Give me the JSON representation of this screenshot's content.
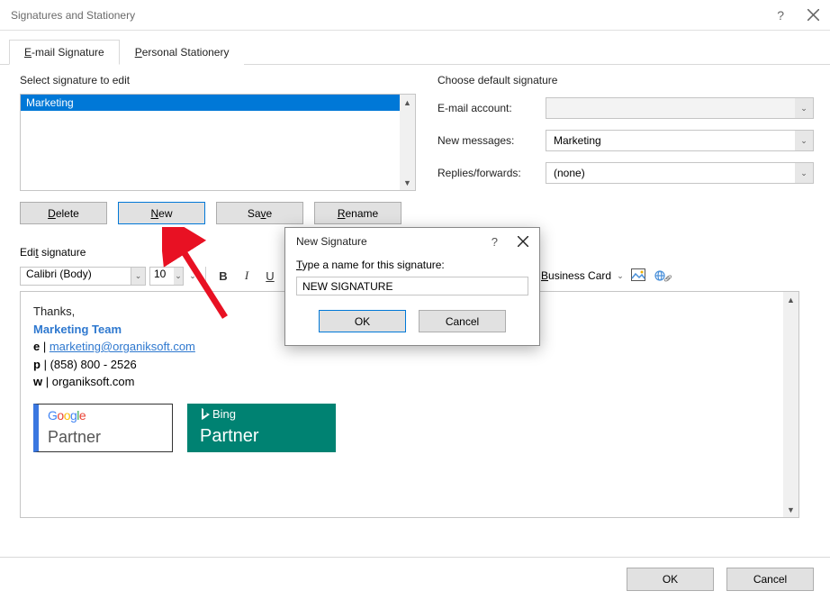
{
  "titlebar": {
    "title": "Signatures and Stationery"
  },
  "tabs": {
    "email": "E-mail Signature",
    "personal": "Personal Stationery"
  },
  "select_label": "Select signature to edit",
  "signatures": [
    "Marketing"
  ],
  "buttons": {
    "delete": "Delete",
    "new": "New",
    "save": "Save",
    "rename": "Rename"
  },
  "defaults": {
    "heading": "Choose default signature",
    "email_account_label": "E-mail account:",
    "email_account_value": "",
    "new_messages_label": "New messages:",
    "new_messages_value": "Marketing",
    "replies_label": "Replies/forwards:",
    "replies_value": "(none)"
  },
  "edit_label": "Edit signature",
  "toolbar": {
    "font": "Calibri (Body)",
    "size": "10",
    "business_card": "Business Card"
  },
  "signature_content": {
    "thanks": "Thanks,",
    "team": "Marketing Team",
    "email_label": "e",
    "email": "marketing@organiksoft.com",
    "phone_label": "p",
    "phone": "(858) 800 - 2526",
    "web_label": "w",
    "web": "organiksoft.com"
  },
  "badges": {
    "google_partner": "Partner",
    "bing_label": "Bing",
    "bing_partner": "Partner"
  },
  "bottom": {
    "ok": "OK",
    "cancel": "Cancel"
  },
  "modal": {
    "title": "New Signature",
    "prompt": "Type a name for this signature:",
    "value": "NEW SIGNATURE",
    "ok": "OK",
    "cancel": "Cancel"
  }
}
